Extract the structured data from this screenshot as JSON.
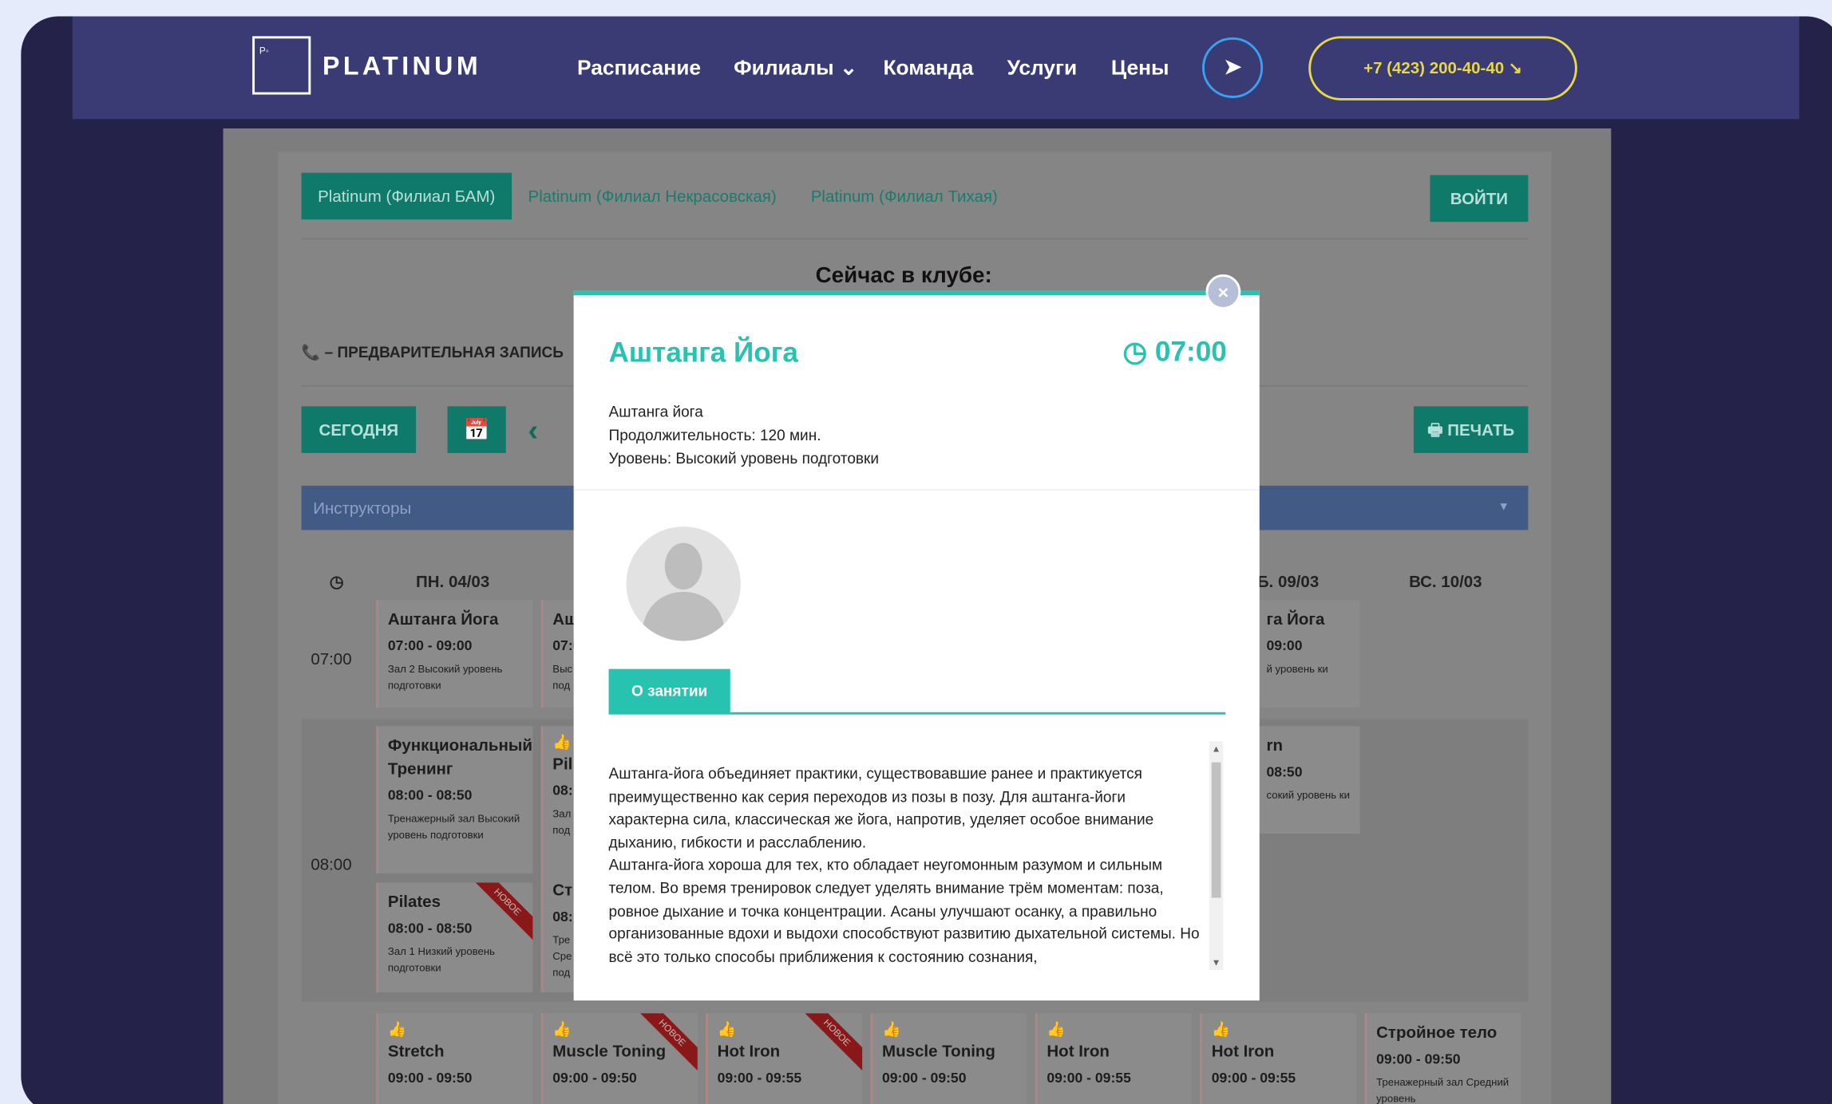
{
  "nav": {
    "logo_mark": "P◦",
    "logo_text": "PLATINUM",
    "items": [
      "Расписание",
      "Филиалы ⌄",
      "Команда",
      "Услуги",
      "Цены"
    ],
    "telegram_icon": "telegram-icon",
    "phone": "+7 (423) 200-40-40 ↘"
  },
  "branches": [
    "Platinum (Филиал БАМ)",
    "Platinum (Филиал Некрасовская)",
    "Platinum (Филиал Тихая)"
  ],
  "login": "ВОЙТИ",
  "now_title": "Сейчас в клубе:",
  "legend": "📞 – ПРЕДВАРИТЕЛЬНАЯ ЗАПИСЬ",
  "today": "СЕГОДНЯ",
  "calendar_icon": "📅",
  "prev_icon": "‹",
  "print": "🖶 ПЕЧАТЬ",
  "instructors": "Инструкторы",
  "schedule": {
    "clock": "◷",
    "days": [
      "ПН. 04/03",
      "ВС. 10/03"
    ],
    "day_partial": "Б. 09/03",
    "times": [
      "07:00",
      "08:00"
    ],
    "like": "👍",
    "new_badge": "НОВОЕ",
    "cards": [
      {
        "title": "Аштанга Йога",
        "hours": "07:00 - 09:00",
        "sub": "Зал 2 Высокий уровень подготовки"
      },
      {
        "title": "Ашт",
        "hours": "07:0",
        "sub": "Выс под"
      },
      {
        "title": "Функциональный Тренинг",
        "hours": "08:00 - 08:50",
        "sub": "Тренажерный зал Высокий уровень подготовки"
      },
      {
        "title": "Pil",
        "hours": "08:",
        "sub": "Зал под"
      },
      {
        "title": "Pilates",
        "hours": "08:00 - 08:50",
        "sub": "Зал 1 Низкий уровень подготовки"
      },
      {
        "title": "Ст",
        "hours": "08:",
        "sub": "Тре Сре под"
      },
      {
        "title": "Stretch",
        "hours": "09:00 - 09:50",
        "sub": ""
      },
      {
        "title": "Muscle Toning",
        "hours": "09:00 - 09:50",
        "sub": ""
      },
      {
        "title": "Hot Iron",
        "hours": "09:00 - 09:55",
        "sub": ""
      },
      {
        "title": "Muscle Toning",
        "hours": "09:00 - 09:50",
        "sub": ""
      },
      {
        "title": "Hot Iron",
        "hours": "09:00 - 09:55",
        "sub": ""
      },
      {
        "title": "Hot Iron",
        "hours": "09:00 - 09:55",
        "sub": ""
      },
      {
        "title": "Стройное тело",
        "hours": "09:00 - 09:50",
        "sub": "Тренажерный зал Средний уровень"
      },
      {
        "title": "га Йога",
        "hours": "09:00",
        "sub": "й уровень ки"
      },
      {
        "title": "rn",
        "hours": "08:50",
        "sub": "сокий уровень ки"
      }
    ]
  },
  "modal": {
    "title": "Аштанга Йога",
    "time": "◷ 07:00",
    "info": [
      "Аштанга йога",
      "Продолжительность: 120 мин.",
      "Уровень: Высокий уровень подготовки"
    ],
    "tab": "О занятии",
    "close": "×",
    "description": [
      "Аштанга-йога объединяет практики, существовавшие ранее и практикуется преимущественно как серия переходов из позы в позу. Для аштанга-йоги характерна сила, классическая же йога, напротив, уделяет особое внимание дыханию, гибкости и расслаблению.",
      "Аштанга-йога хороша для тех, кто обладает неугомонным разумом и сильным телом. Во время тренировок следует уделять внимание трём моментам: поза, ровное дыхание и точка концентрации. Асаны улучшают осанку, а правильно организованные вдохи и выдохи способствуют развитию дыхательной системы. Но всё это только способы приближения к состоянию сознания,"
    ]
  }
}
